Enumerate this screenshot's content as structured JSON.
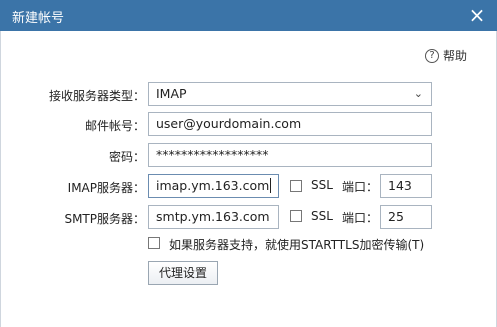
{
  "window": {
    "title": "新建帐号",
    "close_glyph": "×"
  },
  "help": {
    "icon_glyph": "?",
    "label": "帮助"
  },
  "form": {
    "server_type": {
      "label": "接收服务器类型：",
      "value": "IMAP",
      "arrow_glyph": "⌄"
    },
    "account": {
      "label": "邮件帐号：",
      "value": "user@yourdomain.com"
    },
    "password": {
      "label": "密码：",
      "value": "******************"
    },
    "imap": {
      "label": "IMAP服务器：",
      "value": "imap.ym.163.com",
      "ssl_label": "SSL",
      "ssl_checked": false,
      "port_label": "端口：",
      "port_value": "143"
    },
    "smtp": {
      "label": "SMTP服务器：",
      "value": "smtp.ym.163.com",
      "ssl_label": "SSL",
      "ssl_checked": false,
      "port_label": "端口：",
      "port_value": "25"
    },
    "starttls": {
      "label": "如果服务器支持，就使用STARTTLS加密传输(T)",
      "checked": false
    },
    "proxy_button": "代理设置"
  }
}
